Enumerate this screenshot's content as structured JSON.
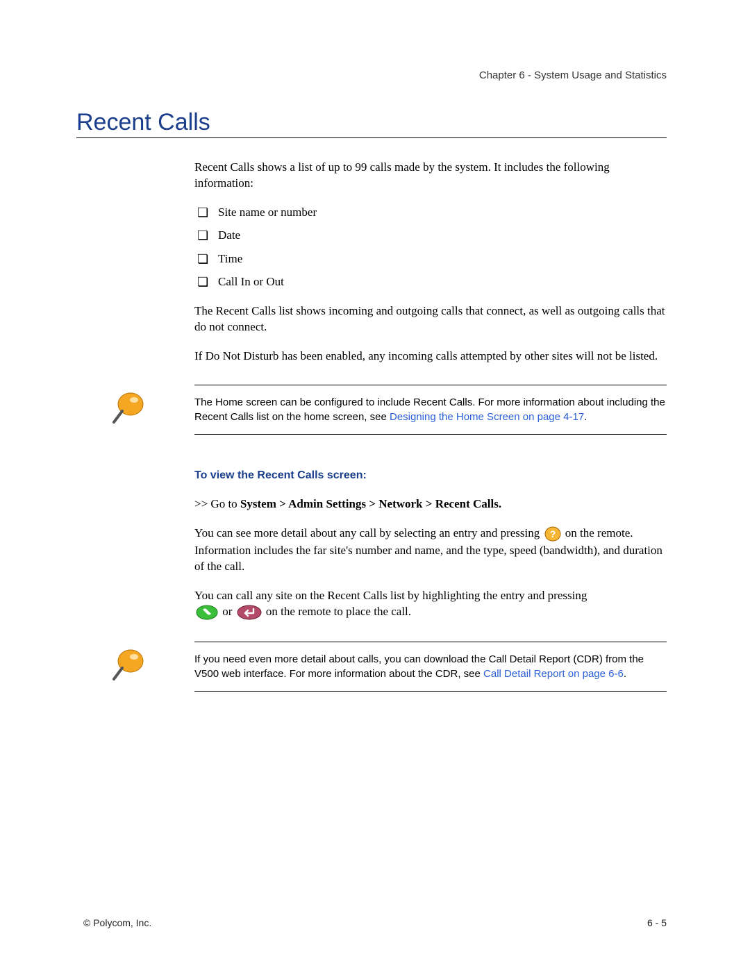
{
  "header": "Chapter 6 - System Usage and Statistics",
  "title": "Recent Calls",
  "intro": "Recent Calls shows a list of up to 99 calls made by the system. It includes the following information:",
  "bullets": [
    "Site name or number",
    "Date",
    "Time",
    "Call In or Out"
  ],
  "para_connect": "The Recent Calls list shows incoming and outgoing calls that connect, as well as outgoing calls that do not connect.",
  "para_dnd": "If Do Not Disturb has been enabled, any incoming calls attempted by other sites will not be listed.",
  "note1_a": "The Home screen can be configured to include Recent Calls. For more information about including the Recent Calls list on the home screen, see ",
  "note1_link": "Designing the Home Screen on page 4-17",
  "note1_b": ".",
  "sub_heading": "To view the Recent Calls screen:",
  "goto_prefix": ">> Go to ",
  "goto_bold": "System > Admin Settings > Network > Recent Calls.",
  "detail_a": "You can see more detail about any call by selecting an entry and pressing ",
  "detail_b": " on the remote. Information includes the far site's number and name, and the type, speed (bandwidth), and duration of the call.",
  "call_a": "You can call any site on the Recent Calls list by highlighting the entry and pressing ",
  "call_or": " or ",
  "call_b": " on the remote to place the call.",
  "note2_a": "If you need even more detail about calls, you can download the Call Detail Report (CDR) from the V500 web interface. For more information about the CDR, see ",
  "note2_link": "Call Detail Report on page 6-6",
  "note2_b": ".",
  "footer_left": "© Polycom, Inc.",
  "footer_right": "6 - 5"
}
